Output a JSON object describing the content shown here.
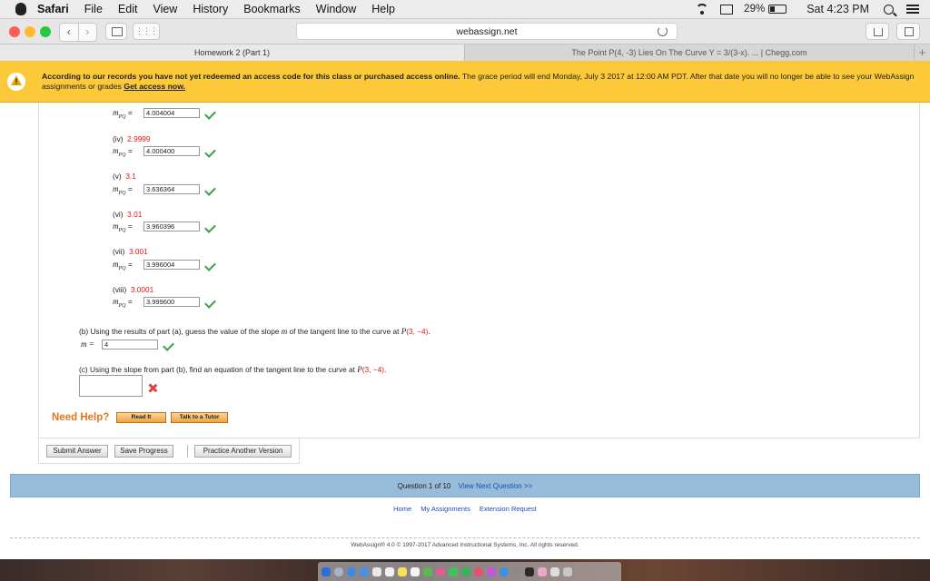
{
  "menubar": {
    "items": [
      "Safari",
      "File",
      "Edit",
      "View",
      "History",
      "Bookmarks",
      "Window",
      "Help"
    ],
    "battery": "29%",
    "clock": "Sat 4:23 PM"
  },
  "toolbar": {
    "url": "webassign.net"
  },
  "tabs": {
    "active": "Homework 2 (Part 1)",
    "inactive": "The Point P(4, -3) Lies On The Curve Y = 3/(3-x). ... | Chegg.com",
    "plus": "+"
  },
  "banner": {
    "icon": "!",
    "bold": "According to our records you have not yet redeemed an access code for this class or purchased access online.",
    "text": " The grace period will end Monday, July 3 2017 at 12:00 AM PDT. After that date you will no longer be able to see your WebAssign assignments or grades ",
    "link": "Get access now."
  },
  "parts": [
    {
      "label": "",
      "x": "",
      "value": "4.004004"
    },
    {
      "label": "(iv)",
      "x": "2.9999",
      "value": "4.000400"
    },
    {
      "label": "(v)",
      "x": "3.1",
      "value": "3.636364"
    },
    {
      "label": "(vi)",
      "x": "3.01",
      "value": "3.960396"
    },
    {
      "label": "(vii)",
      "x": "3.001",
      "value": "3.996004"
    },
    {
      "label": "(viii)",
      "x": "3.0001",
      "value": "3.999600"
    }
  ],
  "mpq": {
    "m": "m",
    "sub": "PQ",
    "eq": "="
  },
  "part_b": {
    "pre": "(b) Using the results of part (a), guess the value of the slope ",
    "m": "m",
    "mid": " of the tangent line to the curve at ",
    "p": "P",
    "point": "(3, −4)",
    "end": ".",
    "m_eq": "m =",
    "value": "4"
  },
  "part_c": {
    "pre": "(c) Using the slope from part (b), find an equation of the tangent line to the curve at ",
    "p": "P",
    "point": "(3, −4)",
    "end": "."
  },
  "help": {
    "title": "Need Help?",
    "read": "Read It",
    "tutor": "Talk to a Tutor"
  },
  "actions": {
    "submit": "Submit Answer",
    "save": "Save Progress",
    "practice": "Practice Another Version"
  },
  "qnav": {
    "text": "Question 1 of 10",
    "next": "View Next Question >>"
  },
  "links": [
    "Home",
    "My Assignments",
    "Extension Request"
  ],
  "footer": "WebAssign® 4.0 © 1997-2017 Advanced Instructional Systems, Inc. All rights reserved.",
  "colors": {
    "banner": "#fbc93a",
    "correct": "#3aa24a",
    "incorrect": "#e04040",
    "help": "#e8751a",
    "qbar": "#97bcd9"
  }
}
